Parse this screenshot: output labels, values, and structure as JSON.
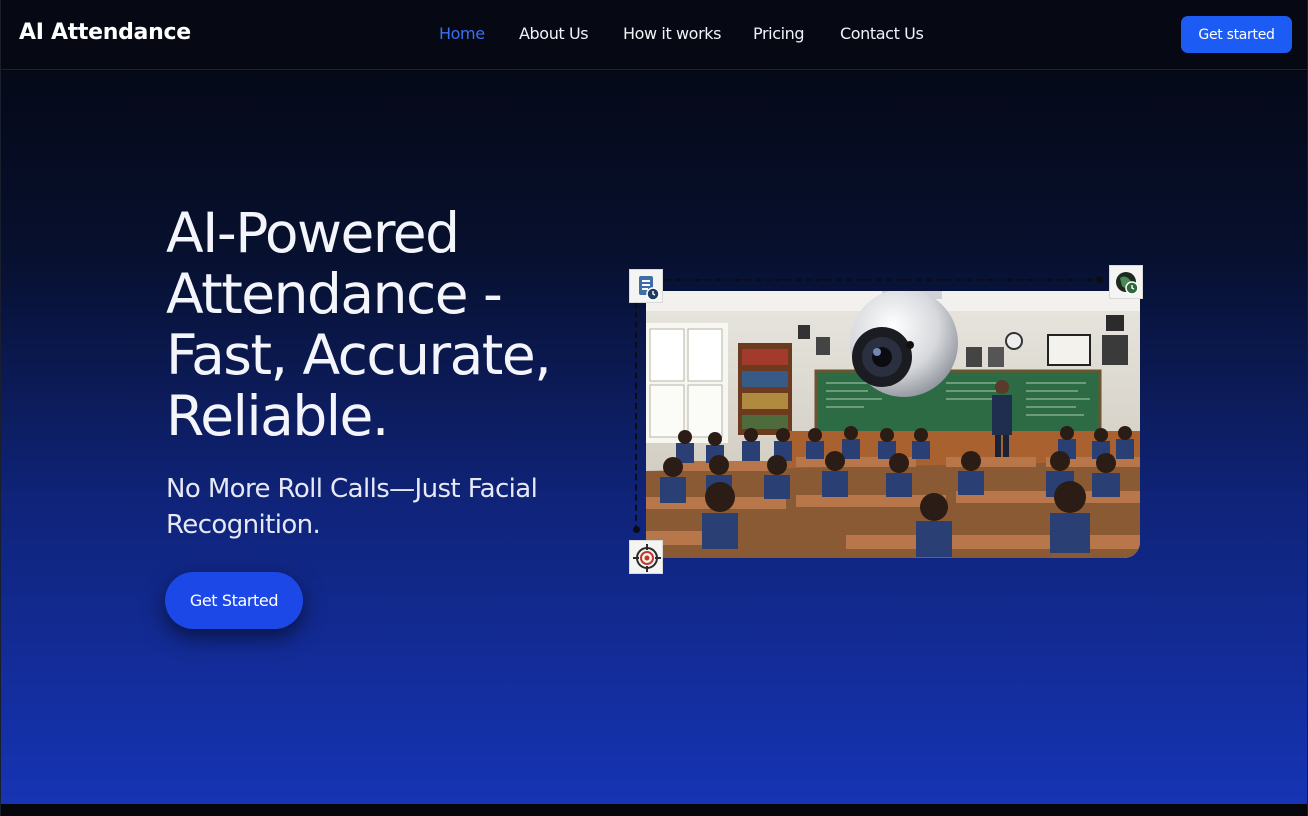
{
  "brand": {
    "name": "AI Attendance"
  },
  "nav": {
    "links": [
      {
        "label": "Home",
        "active": true
      },
      {
        "label": "About Us",
        "active": false
      },
      {
        "label": "How it works",
        "active": false
      },
      {
        "label": "Pricing",
        "active": false
      },
      {
        "label": "Contact Us",
        "active": false
      }
    ],
    "cta_label": "Get started"
  },
  "hero": {
    "title": "AI-Powered Attendance - Fast, Accurate, Reliable.",
    "subtitle": "No More Roll Calls—Just Facial Recognition.",
    "cta_label": "Get Started",
    "image": {
      "subject": "classroom-with-security-camera",
      "badges": [
        "document-clock-icon",
        "globe-clock-icon",
        "target-icon"
      ]
    }
  },
  "colors": {
    "accent": "#1c5cf5",
    "nav_active": "#3d6ff2",
    "hero_top": "#050918",
    "hero_bottom": "#1634b4"
  }
}
